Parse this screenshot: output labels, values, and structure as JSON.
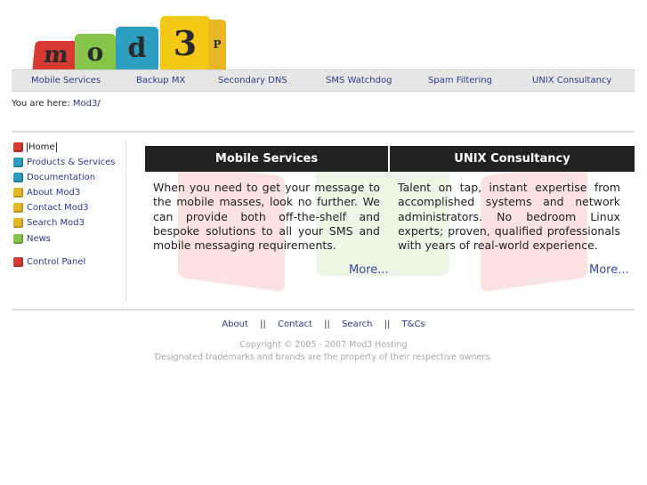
{
  "logo": {
    "letters": [
      "m",
      "o",
      "d",
      "3",
      "P"
    ],
    "colors": [
      "#d63a32",
      "#86c44a",
      "#2c9ec0",
      "#f4c915",
      "#e7b826"
    ]
  },
  "topnav": {
    "items": [
      {
        "label": "Mobile Services"
      },
      {
        "label": "Backup MX"
      },
      {
        "label": "Secondary DNS"
      },
      {
        "label": "SMS Watchdog"
      },
      {
        "label": "Spam Filtering"
      },
      {
        "label": "UNIX Consultancy"
      }
    ]
  },
  "breadcrumb": {
    "prefix": "You are here:",
    "link": "Mod3",
    "separator": "/"
  },
  "sidebar": {
    "items": [
      {
        "label": "Home",
        "color": "#d63a32"
      },
      {
        "label": "Products & Services",
        "color": "#2c9ec0"
      },
      {
        "label": "Documentation",
        "color": "#2c9ec0"
      },
      {
        "label": "About Mod3",
        "color": "#e7b826"
      },
      {
        "label": "Contact Mod3",
        "color": "#e7b826"
      },
      {
        "label": "Search Mod3",
        "color": "#e7b826"
      },
      {
        "label": "News",
        "color": "#86c44a"
      },
      {
        "label": "Control Panel",
        "color": "#d63a32"
      }
    ]
  },
  "panels": [
    {
      "title": "Mobile Services",
      "body": "When you need to get your message to the mobile masses, look no further. We can provide both off-the-shelf and bespoke solutions to all your SMS and mobile messaging requirements.",
      "more": "More..."
    },
    {
      "title": "UNIX Consultancy",
      "body": "Talent on tap, instant expertise from accomplished systems and network administrators. No bedroom Linux experts; proven, qualified professionals with years of real-world experience.",
      "more": "More..."
    }
  ],
  "footer": {
    "links": [
      "About",
      "Contact",
      "Search",
      "T&Cs"
    ],
    "separator": "||",
    "copyright": "Copyright © 2005 - 2007 Mod3 Hosting",
    "trademarks": "Designated trademarks and brands are the property of their respective owners."
  }
}
